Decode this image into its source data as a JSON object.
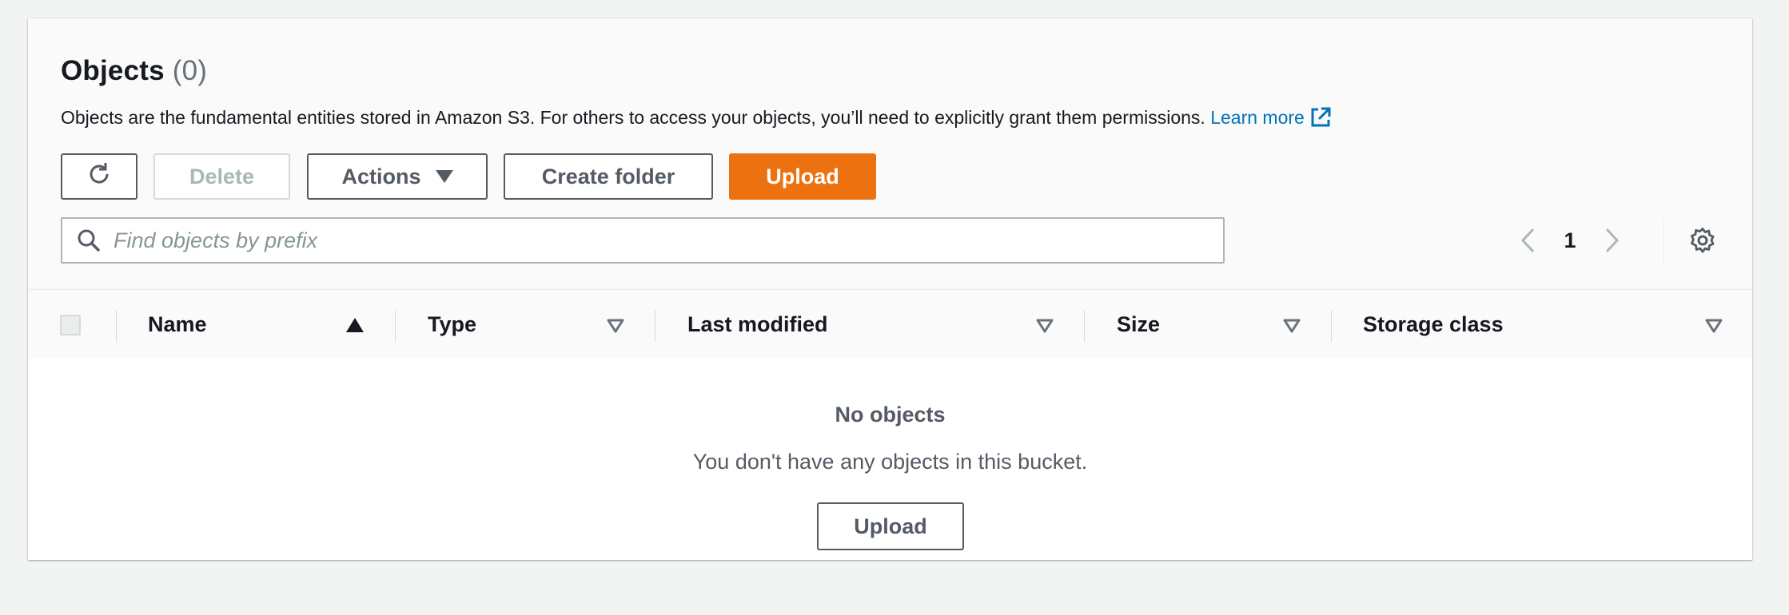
{
  "section": {
    "title": "Objects",
    "count": "(0)",
    "description": "Objects are the fundamental entities stored in Amazon S3. For others to access your objects, you’ll need to explicitly grant them permissions.",
    "learn_more": "Learn more"
  },
  "toolbar": {
    "delete_label": "Delete",
    "actions_label": "Actions",
    "create_folder_label": "Create folder",
    "upload_label": "Upload"
  },
  "search": {
    "placeholder": "Find objects by prefix",
    "value": ""
  },
  "pagination": {
    "current_page": "1"
  },
  "table": {
    "columns": [
      {
        "label": "Name",
        "sort": "ascending"
      },
      {
        "label": "Type",
        "sort": "none"
      },
      {
        "label": "Last modified",
        "sort": "none"
      },
      {
        "label": "Size",
        "sort": "none"
      },
      {
        "label": "Storage class",
        "sort": "none"
      }
    ],
    "empty_title": "No objects",
    "empty_description": "You don't have any objects in this bucket.",
    "empty_upload_label": "Upload"
  },
  "colors": {
    "primary": "#ec7211",
    "link": "#0073bb",
    "text": "#16191f",
    "muted": "#545b64",
    "background": "#f2f3f3"
  },
  "icons": [
    "refresh-icon",
    "caret-down-icon",
    "external-link-icon",
    "search-icon",
    "chevron-left-icon",
    "chevron-right-icon",
    "gear-icon",
    "sort-ascending-icon",
    "sort-descending-icon"
  ]
}
